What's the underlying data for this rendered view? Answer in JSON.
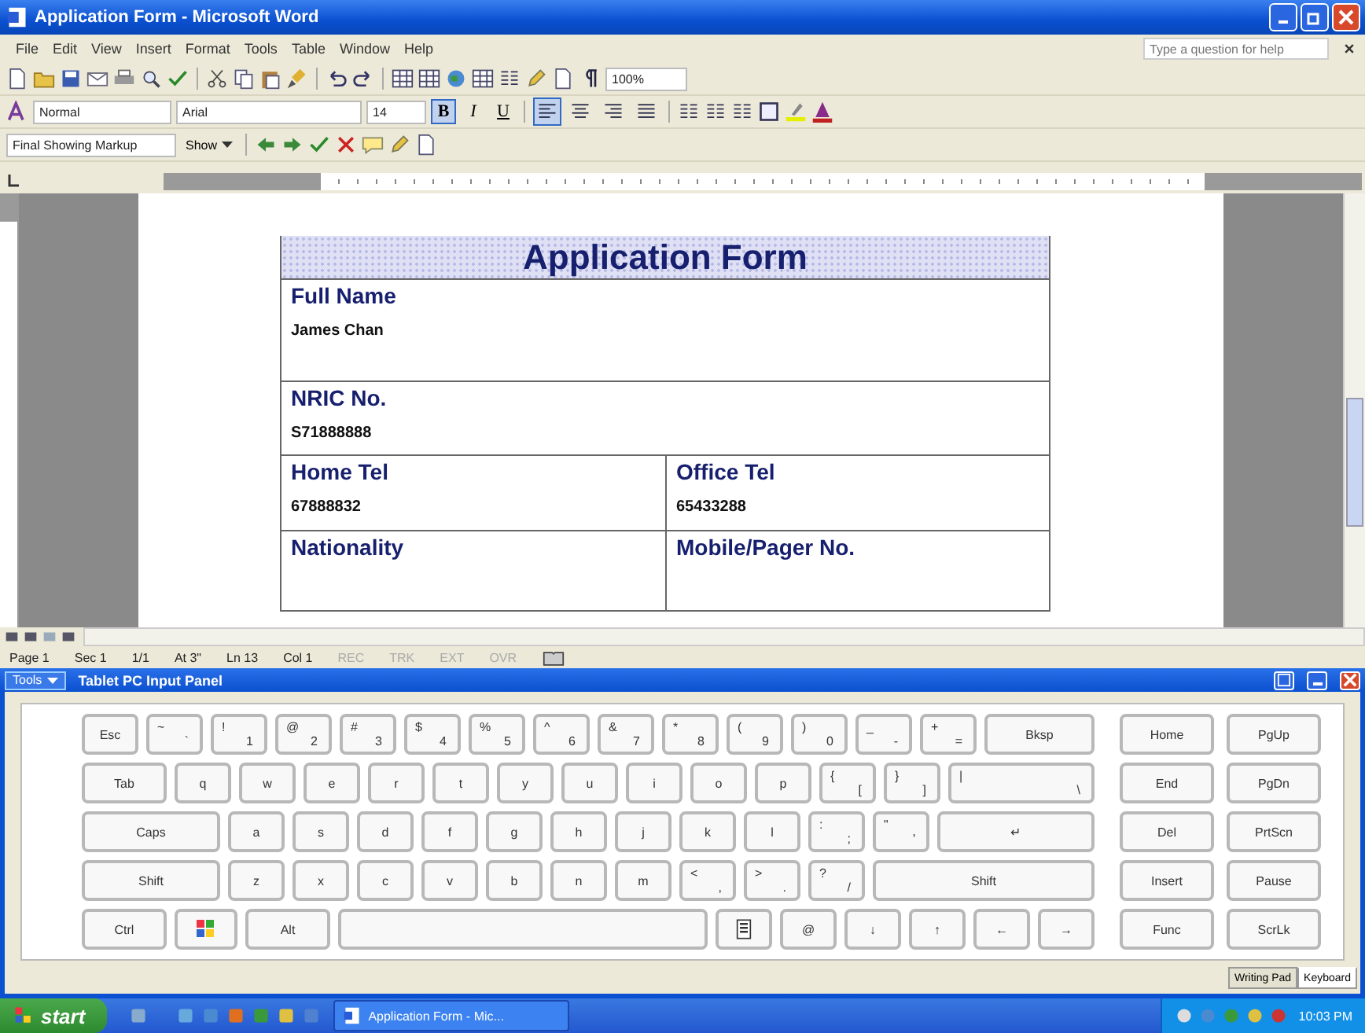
{
  "window": {
    "title": "Application Form - Microsoft Word"
  },
  "menu": [
    "File",
    "Edit",
    "View",
    "Insert",
    "Format",
    "Tools",
    "Table",
    "Window",
    "Help"
  ],
  "help_box": {
    "placeholder": "Type a question for help"
  },
  "standard_toolbar": {
    "zoom": "100%"
  },
  "formatting_toolbar": {
    "style": "Normal",
    "font": "Arial",
    "size": "14",
    "font_style_buttons": [
      {
        "kind": "bold",
        "label": "B",
        "selected": true
      },
      {
        "kind": "italic",
        "label": "I",
        "selected": false
      },
      {
        "kind": "underline",
        "label": "U",
        "selected": false
      }
    ],
    "align_buttons": [
      {
        "kind": "left",
        "selected": true
      },
      {
        "kind": "center",
        "selected": false
      },
      {
        "kind": "right",
        "selected": false
      },
      {
        "kind": "justify",
        "selected": false
      }
    ]
  },
  "reviewing_toolbar": {
    "markup": "Final Showing Markup",
    "show": "Show"
  },
  "document": {
    "title": "Application Form",
    "rows": [
      {
        "cells": [
          {
            "label": "Full Name",
            "value": "James Chan"
          }
        ]
      },
      {
        "cells": [
          {
            "label": "NRIC No.",
            "value": "S71888888"
          }
        ]
      },
      {
        "cells": [
          {
            "label": "Home Tel",
            "value": "67888832"
          },
          {
            "label": "Office Tel",
            "value": "65433288"
          }
        ]
      },
      {
        "cells": [
          {
            "label": "Nationality"
          },
          {
            "label": "Mobile/Pager No."
          }
        ]
      }
    ]
  },
  "status_bar": [
    {
      "text": "Page 1",
      "disabled": false
    },
    {
      "text": "Sec 1",
      "disabled": false
    },
    {
      "text": "1/1",
      "disabled": false
    },
    {
      "text": "At 3\"",
      "disabled": false
    },
    {
      "text": "Ln 13",
      "disabled": false
    },
    {
      "text": "Col 1",
      "disabled": false
    },
    {
      "text": "REC",
      "disabled": true
    },
    {
      "text": "TRK",
      "disabled": true
    },
    {
      "text": "EXT",
      "disabled": true
    },
    {
      "text": "OVR",
      "disabled": true
    }
  ],
  "input_panel": {
    "tools": "Tools",
    "title": "Tablet PC Input Panel",
    "rows": [
      {
        "keys": [
          {
            "kind": "key",
            "label": "Esc"
          },
          {
            "kind": "char",
            "top": "~",
            "label": "`"
          },
          {
            "kind": "char",
            "top": "!",
            "label": "1"
          },
          {
            "kind": "char",
            "top": "@",
            "label": "2"
          },
          {
            "kind": "char",
            "top": "#",
            "label": "3"
          },
          {
            "kind": "char",
            "top": "$",
            "label": "4"
          },
          {
            "kind": "char",
            "top": "%",
            "label": "5"
          },
          {
            "kind": "char",
            "top": "^",
            "label": "6"
          },
          {
            "kind": "char",
            "top": "&",
            "label": "7"
          },
          {
            "kind": "char",
            "top": "*",
            "label": "8"
          },
          {
            "kind": "char",
            "top": "(",
            "label": "9"
          },
          {
            "kind": "char",
            "top": ")",
            "label": "0"
          },
          {
            "kind": "char",
            "top": "_",
            "label": "-"
          },
          {
            "kind": "char",
            "top": "+",
            "label": "="
          },
          {
            "kind": "wide",
            "label": "Bksp"
          }
        ],
        "nav": [
          "Home",
          "PgUp"
        ]
      },
      {
        "keys": [
          {
            "kind": "mod",
            "label": "Tab"
          },
          {
            "kind": "key",
            "label": "q"
          },
          {
            "kind": "key",
            "label": "w"
          },
          {
            "kind": "key",
            "label": "e"
          },
          {
            "kind": "key",
            "label": "r"
          },
          {
            "kind": "key",
            "label": "t"
          },
          {
            "kind": "key",
            "label": "y"
          },
          {
            "kind": "key",
            "label": "u"
          },
          {
            "kind": "key",
            "label": "i"
          },
          {
            "kind": "key",
            "label": "o"
          },
          {
            "kind": "key",
            "label": "p"
          },
          {
            "kind": "char",
            "top": "{",
            "label": "["
          },
          {
            "kind": "char",
            "top": "}",
            "label": "]"
          },
          {
            "kind": "widechar",
            "top": "|",
            "label": "\\"
          }
        ],
        "nav": [
          "End",
          "PgDn"
        ]
      },
      {
        "keys": [
          {
            "kind": "large",
            "label": "Caps"
          },
          {
            "kind": "key",
            "label": "a"
          },
          {
            "kind": "key",
            "label": "s"
          },
          {
            "kind": "key",
            "label": "d"
          },
          {
            "kind": "key",
            "label": "f"
          },
          {
            "kind": "key",
            "label": "g"
          },
          {
            "kind": "key",
            "label": "h"
          },
          {
            "kind": "key",
            "label": "j"
          },
          {
            "kind": "key",
            "label": "k"
          },
          {
            "kind": "key",
            "label": "l"
          },
          {
            "kind": "char",
            "top": ":",
            "label": ";"
          },
          {
            "kind": "char",
            "top": "\"",
            "label": "'"
          },
          {
            "kind": "wide",
            "label": "↵"
          }
        ],
        "nav": [
          "Del",
          "PrtScn"
        ]
      },
      {
        "keys": [
          {
            "kind": "large",
            "label": "Shift"
          },
          {
            "kind": "key",
            "label": "z"
          },
          {
            "kind": "key",
            "label": "x"
          },
          {
            "kind": "key",
            "label": "c"
          },
          {
            "kind": "key",
            "label": "v"
          },
          {
            "kind": "key",
            "label": "b"
          },
          {
            "kind": "key",
            "label": "n"
          },
          {
            "kind": "key",
            "label": "m"
          },
          {
            "kind": "char",
            "top": "<",
            "label": ","
          },
          {
            "kind": "char",
            "top": ">",
            "label": "."
          },
          {
            "kind": "char",
            "top": "?",
            "label": "/"
          },
          {
            "kind": "wide",
            "label": "Shift"
          }
        ],
        "nav": [
          "Insert",
          "Pause"
        ]
      },
      {
        "keys": [
          {
            "kind": "mod",
            "label": "Ctrl"
          },
          {
            "kind": "win"
          },
          {
            "kind": "mod",
            "label": "Alt"
          },
          {
            "kind": "space"
          },
          {
            "kind": "menu"
          },
          {
            "kind": "key",
            "label": "@"
          },
          {
            "kind": "key",
            "label": "↓"
          },
          {
            "kind": "key",
            "label": "↑"
          },
          {
            "kind": "key",
            "label": "←"
          },
          {
            "kind": "key",
            "label": "→"
          }
        ],
        "nav": [
          "Func",
          "ScrLk"
        ]
      }
    ],
    "tabs": [
      {
        "label": "Writing Pad",
        "selected": false
      },
      {
        "label": "Keyboard",
        "selected": true
      }
    ]
  },
  "taskbar": {
    "start": "start",
    "tasks": [
      {
        "label": "Application Form - Mic...",
        "selected": false
      }
    ],
    "clock": "10:03 PM"
  }
}
